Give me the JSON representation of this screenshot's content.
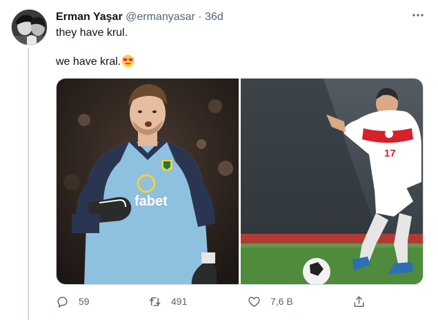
{
  "tweet": {
    "author_name": "Erman Yaşar",
    "handle": "@ermanyasar",
    "separator": "·",
    "time": "36d",
    "line1": "they have krul.",
    "line2": "we have kral.",
    "emoji_icon": "heart-eyes-emoji-icon"
  },
  "photos": [
    {
      "logo_text": "fabet",
      "icon": "goalkeeper-photo"
    },
    {
      "shirt_number": "17",
      "icon": "footballer-photo"
    }
  ],
  "actions": {
    "reply_count": "59",
    "retweet_count": "491",
    "like_count": "7,6 B",
    "share_icon": "share-icon"
  },
  "colors": {
    "text": "#0f1419",
    "secondary": "#536471",
    "border": "#cfd9de"
  }
}
